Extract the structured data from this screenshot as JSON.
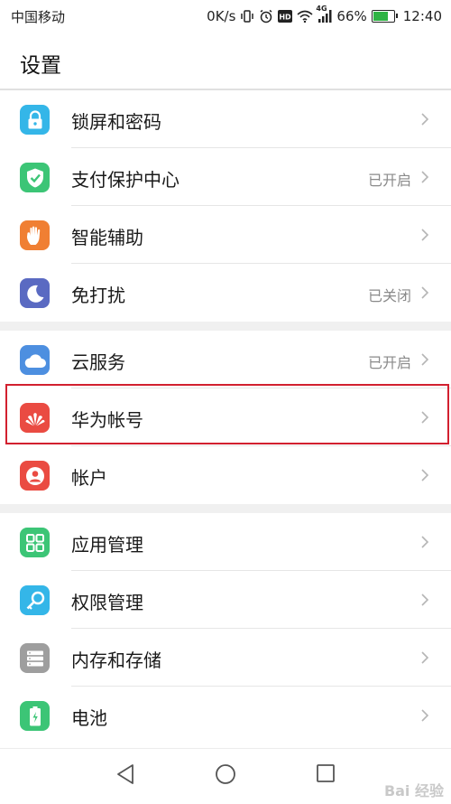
{
  "status_bar": {
    "carrier": "中国移动",
    "net_speed": "0K/s",
    "signal_badge": "4G",
    "battery_percent": "66%",
    "battery_level": 0.66,
    "time": "12:40",
    "icons": [
      "vibrate-icon",
      "alarm-icon",
      "hd-icon",
      "wifi-icon",
      "cell-signal-icon",
      "battery-icon"
    ]
  },
  "header": {
    "title": "设置"
  },
  "groups": [
    {
      "items": [
        {
          "label": "锁屏和密码",
          "value": "",
          "icon": "lock-icon",
          "color": "#34b6e8"
        },
        {
          "label": "支付保护中心",
          "value": "已开启",
          "icon": "shield-check-icon",
          "color": "#3cc576"
        },
        {
          "label": "智能辅助",
          "value": "",
          "icon": "hand-icon",
          "color": "#f07f33"
        },
        {
          "label": "免打扰",
          "value": "已关闭",
          "icon": "moon-icon",
          "color": "#5a6ac2"
        }
      ]
    },
    {
      "items": [
        {
          "label": "云服务",
          "value": "已开启",
          "icon": "cloud-icon",
          "color": "#4d8fe0"
        },
        {
          "label": "华为帐号",
          "value": "",
          "icon": "huawei-logo-icon",
          "color": "#ea4b42"
        },
        {
          "label": "帐户",
          "value": "",
          "icon": "person-icon",
          "color": "#ea4b42"
        }
      ]
    },
    {
      "items": [
        {
          "label": "应用管理",
          "value": "",
          "icon": "app-grid-icon",
          "color": "#3cc576"
        },
        {
          "label": "权限管理",
          "value": "",
          "icon": "key-icon",
          "color": "#34b6e8"
        },
        {
          "label": "内存和存储",
          "value": "",
          "icon": "storage-icon",
          "color": "#9e9e9e"
        },
        {
          "label": "电池",
          "value": "",
          "icon": "battery-icon",
          "color": "#3cc576"
        }
      ]
    }
  ],
  "highlighted_item": "华为帐号",
  "nav": {
    "icons": [
      "back-icon",
      "home-icon",
      "recents-icon"
    ]
  },
  "watermark": "Bai 经验"
}
